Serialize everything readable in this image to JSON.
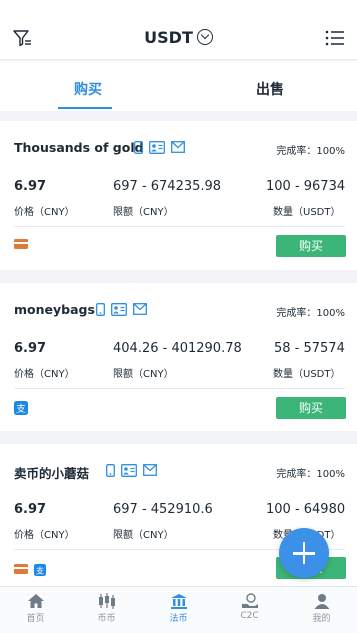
{
  "header": {
    "title": "USDT",
    "filter_icon": "filter-icon",
    "menu_icon": "list-menu-icon"
  },
  "tabs": [
    {
      "label": "购买",
      "active": true
    },
    {
      "label": "出售",
      "active": false
    }
  ],
  "colors": {
    "accent": "#2f8fe0",
    "buy_button": "#3cb578",
    "bank_card": "#e07a3a",
    "alipay": "#1e88e5"
  },
  "offers": [
    {
      "name": "Thousands of gold",
      "completion": "完成率：100%",
      "price": "6.97",
      "price_label": "价格（CNY）",
      "limit": "697 - 674235.98",
      "limit_label": "限额（CNY）",
      "amount": "100 - 96734",
      "amount_label": "数量（USDT）",
      "payments": [
        "bank-card-icon"
      ],
      "button": "购买"
    },
    {
      "name": "moneybags",
      "completion": "完成率：100%",
      "price": "6.97",
      "price_label": "价格（CNY）",
      "limit": "404.26 - 401290.78",
      "limit_label": "限额（CNY）",
      "amount": "58 - 57574",
      "amount_label": "数量（USDT）",
      "payments": [
        "alipay-icon"
      ],
      "button": "购买"
    },
    {
      "name": "卖币的小蘑菇",
      "completion": "完成率：100%",
      "price": "6.97",
      "price_label": "价格（CNY）",
      "limit": "697 - 452910.6",
      "limit_label": "限额（CNY）",
      "amount": "100 - 64980",
      "amount_label": "数量（USDT）",
      "payments": [
        "bank-card-icon",
        "alipay-icon"
      ],
      "button": "购买"
    }
  ],
  "nav": [
    {
      "label": "首页",
      "icon": "home-icon",
      "active": false
    },
    {
      "label": "币币",
      "icon": "candlestick-icon",
      "active": false
    },
    {
      "label": "法币",
      "icon": "bank-icon",
      "active": true
    },
    {
      "label": "C2C",
      "icon": "hand-coin-icon",
      "active": false
    },
    {
      "label": "我的",
      "icon": "user-icon",
      "active": false
    }
  ]
}
